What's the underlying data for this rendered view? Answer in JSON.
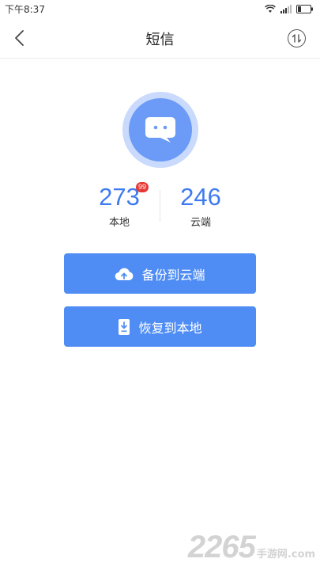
{
  "status_bar": {
    "time": "下午8:37",
    "icons": [
      "wifi-icon",
      "signal-icon",
      "battery-icon"
    ]
  },
  "header": {
    "title": "短信",
    "back_icon": "chevron-left-icon",
    "sort_icon": "sort-arrows-icon"
  },
  "hero": {
    "icon": "message-bubble-icon"
  },
  "stats": {
    "local": {
      "count": "273",
      "label": "本地",
      "badge": "99"
    },
    "cloud": {
      "count": "246",
      "label": "云端"
    }
  },
  "actions": {
    "backup": {
      "label": "备份到云端",
      "icon": "cloud-upload-icon"
    },
    "restore": {
      "label": "恢复到本地",
      "icon": "phone-download-icon"
    }
  },
  "watermark": {
    "number": "2265",
    "text": "手游网",
    "domain": ".com"
  },
  "colors": {
    "accent": "#4f8df5",
    "stat_number": "#3f7af0",
    "badge": "#e53935",
    "avatar_ring": "#c9dafd",
    "avatar_fill": "#6b9bf7"
  }
}
